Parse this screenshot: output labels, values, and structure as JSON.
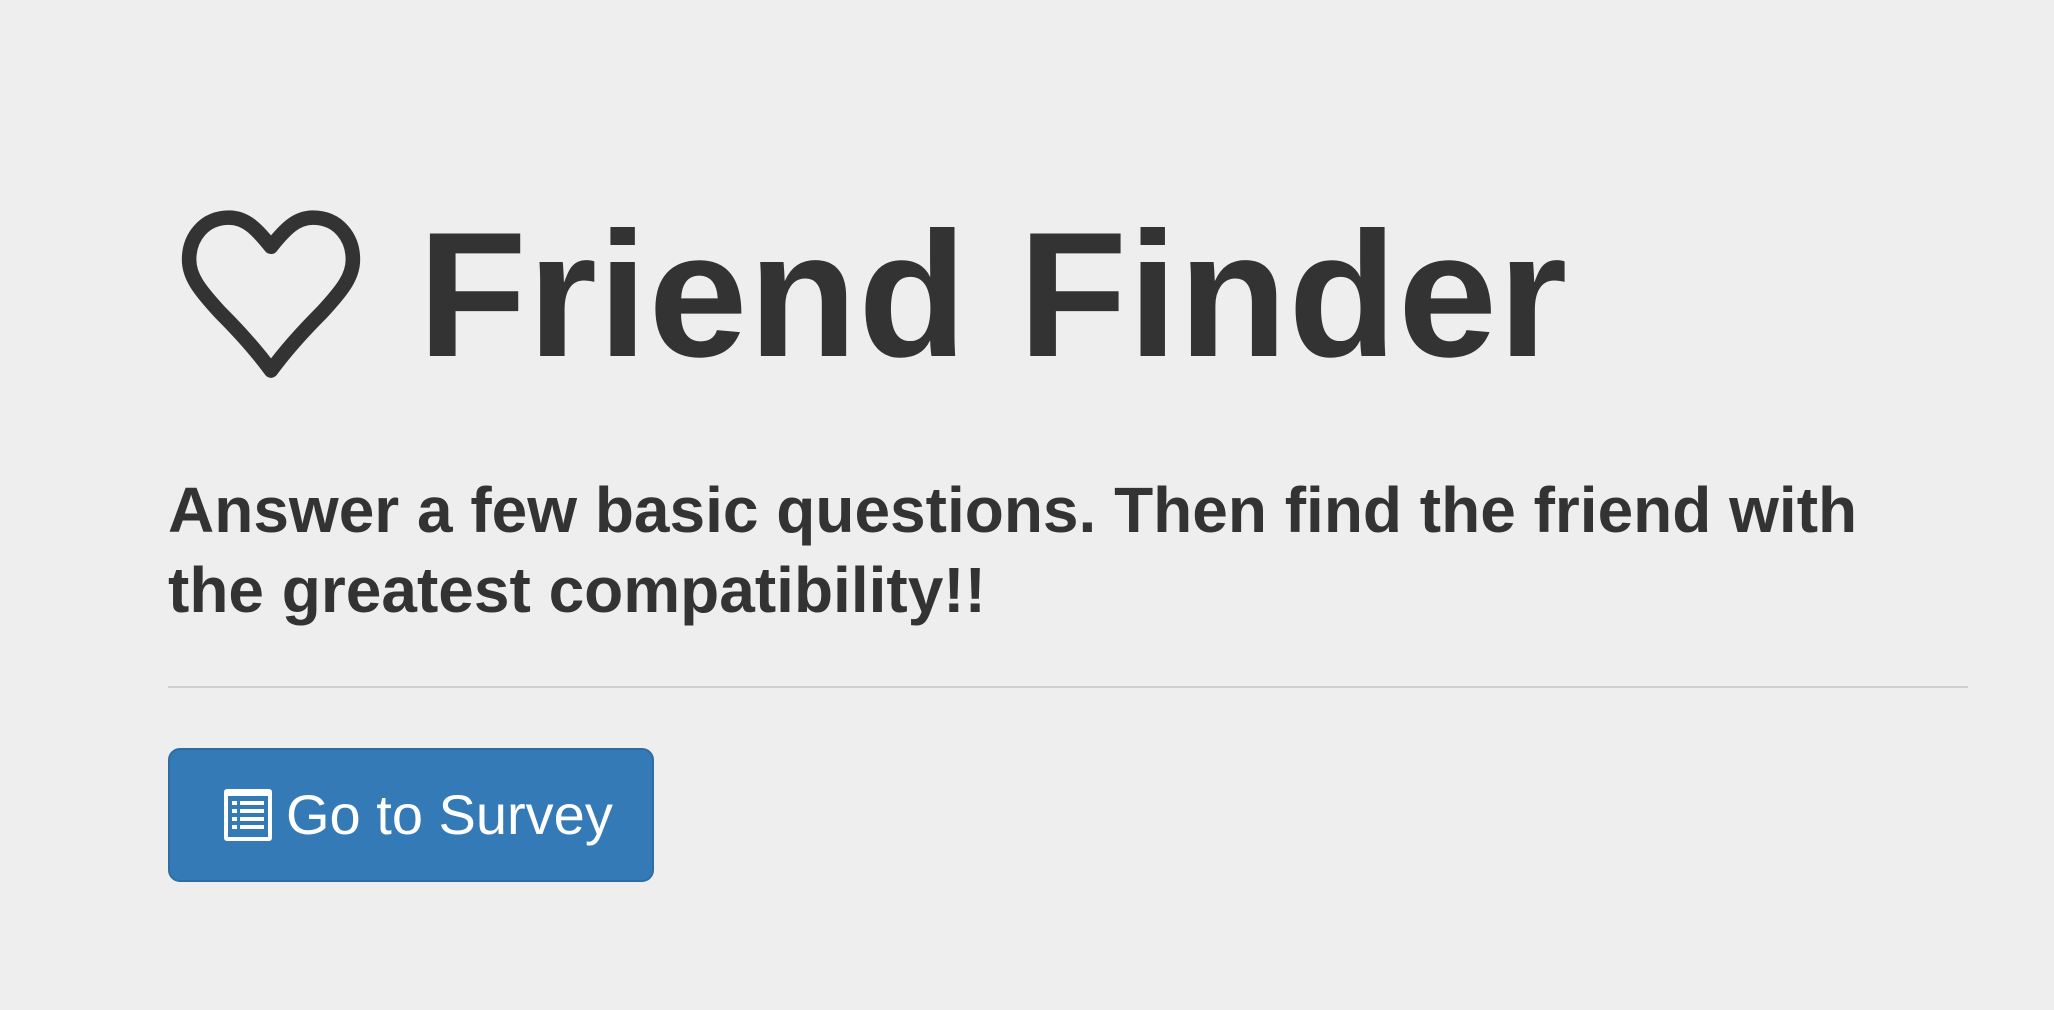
{
  "page": {
    "title": "Friend Finder",
    "title_icon": "heart-icon",
    "lead": "Answer a few basic questions. Then find the friend with the greatest compatibility!!"
  },
  "survey_button": {
    "label": "Go to Survey",
    "icon": "list-alt-icon",
    "color": "#337ab7"
  },
  "colors": {
    "background": "#eeeeee",
    "text": "#333333"
  }
}
